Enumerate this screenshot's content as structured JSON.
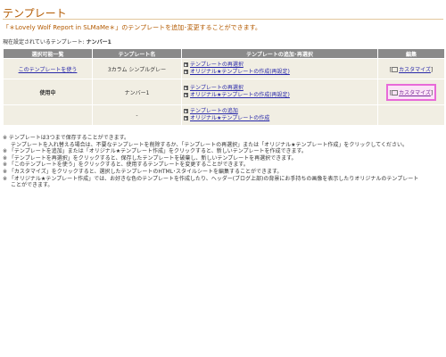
{
  "page": {
    "title": "テンプレート",
    "subtitle": "「＊Lovely Wolf Report in SLMaMe＊」のテンプレートを追加･変更することができます。",
    "current_label": "現在設定されているテンプレート:",
    "current_value": "ナンバー1"
  },
  "table": {
    "headers": [
      "選択可能一覧",
      "テンプレート名",
      "テンプレートの追加･再選択",
      "編集"
    ],
    "rows": [
      {
        "status": "このテンプレートを使う",
        "name": "3カラム シンプルグレー",
        "actions": [
          "テンプレートの再選択",
          "オリジナル★テンプレートの作成(再設定)"
        ],
        "edit": "カスタマイズ",
        "edit_bracket_open": "[",
        "edit_bracket_close": "]"
      },
      {
        "status": "使用中",
        "name": "ナンバー1",
        "actions": [
          "テンプレートの再選択",
          "オリジナル★テンプレートの作成(再設定)"
        ],
        "edit": "カスタマイズ",
        "edit_bracket_open": "[",
        "edit_bracket_close": "]"
      },
      {
        "status": "",
        "name": "-",
        "actions": [
          "テンプレートの追加",
          "オリジナル★テンプレートの作成"
        ],
        "edit": ""
      }
    ]
  },
  "notes": [
    "※ テンプレートは3つまで保存することができます。",
    "テンプレートを入れ替える場合は、不要なテンプレートを削除するか、「テンプレートの再選択」または「オリジナル★テンプレート作成」をクリックしてください。",
    "※ 「テンプレートを追加」または「オリジナル★テンプレート作成」をクリックすると、新しいテンプレートを作成できます。",
    "※ 「テンプレートを再選択」をクリックすると、保存したテンプレートを破棄し、新しいテンプレートを再選択できます。",
    "※ 「このテンプレートを使う」をクリックすると、使用するテンプレートを変更することができます。",
    "※ 「カスタマイズ」をクリックすると、選択したテンプレートのHTML･スタイルシートを編集することができます。",
    "※ 「オリジナル★テンプレート作成」では、お好きな色のテンプレートを作成したり、ヘッダー(ブログ上部)の背景にお手持ちの画像を表示したりオリジナルのテンプレート",
    "ことができます。"
  ],
  "colors": {
    "title": "#b35a00",
    "header_bg": "#8a8a8a",
    "row_bg": "#f1eee3",
    "link": "#2a2aaa",
    "highlight_border": "#e86ad8"
  }
}
